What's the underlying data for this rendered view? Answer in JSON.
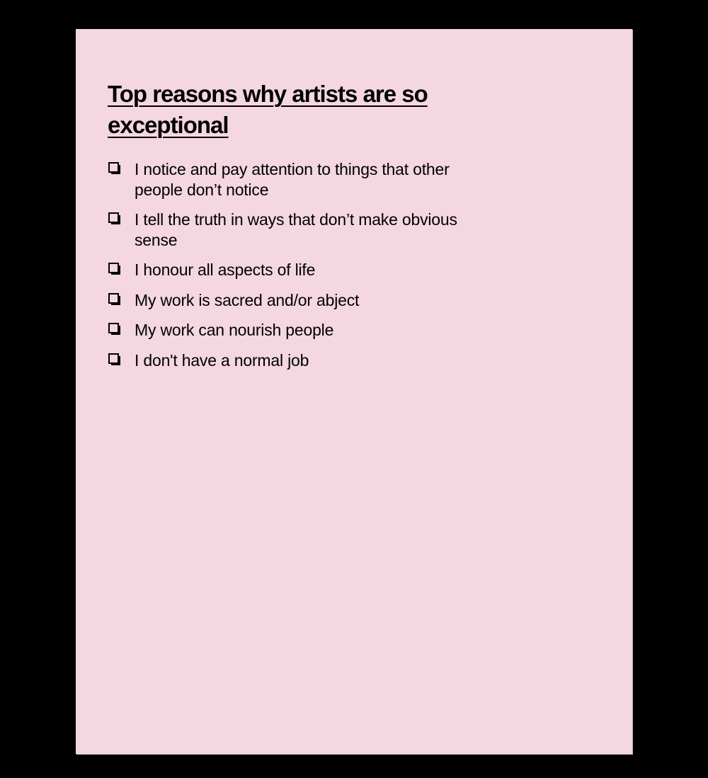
{
  "document": {
    "title": "Top reasons why artists are so exceptional",
    "checklist": [
      "I notice and pay attention to things that other people don’t notice",
      "I tell the truth in ways that don’t make obvious sense",
      "I honour all aspects of life",
      "My work is sacred and/or abject",
      "My work can nourish people",
      "I don't have a normal job"
    ]
  },
  "colors": {
    "page_background": "#000000",
    "sheet_background": "#f4d7e0",
    "text": "#000000"
  },
  "icons": {
    "checkbox": "ballot-box-with-shadow-icon"
  }
}
